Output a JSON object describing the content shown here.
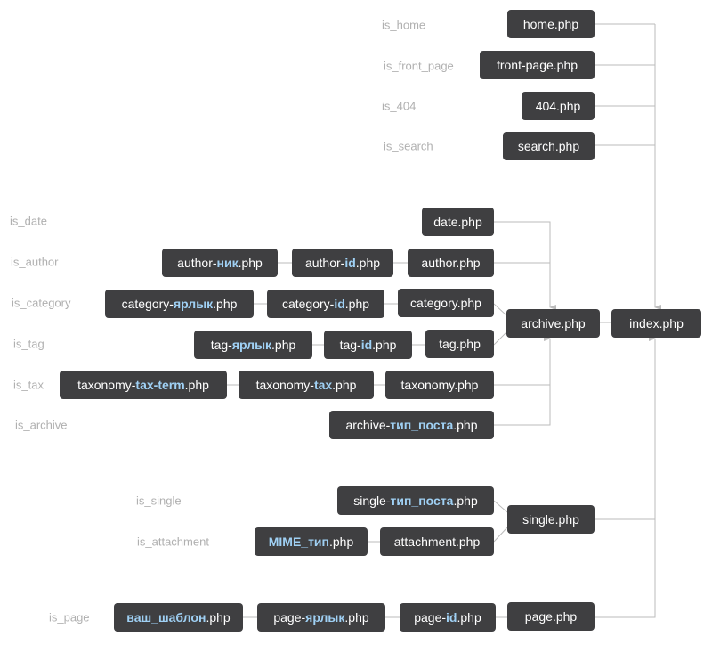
{
  "colors": {
    "node_bg": "#3f3f41",
    "node_text": "#ffffff",
    "highlight": "#9fd0f4",
    "line": "#bbbbbb",
    "condition_text": "#b0b0b0"
  },
  "conditions": [
    "is_home",
    "is_front_page",
    "is_404",
    "is_search",
    "is_date",
    "is_author",
    "is_category",
    "is_tag",
    "is_tax",
    "is_archive",
    "is_single",
    "is_attachment",
    "is_page"
  ],
  "nodes": {
    "home": {
      "pre": "home.php",
      "hl": "",
      "post": ""
    },
    "front_page": {
      "pre": "front-page.php",
      "hl": "",
      "post": ""
    },
    "e404": {
      "pre": "404.php",
      "hl": "",
      "post": ""
    },
    "search": {
      "pre": "search.php",
      "hl": "",
      "post": ""
    },
    "date": {
      "pre": "date.php",
      "hl": "",
      "post": ""
    },
    "author_nick": {
      "pre": "author-",
      "hl": "ник",
      "post": ".php"
    },
    "author_id": {
      "pre": "author-",
      "hl": "id",
      "post": ".php"
    },
    "author": {
      "pre": "author.php",
      "hl": "",
      "post": ""
    },
    "category_slug": {
      "pre": "category-",
      "hl": "ярлык",
      "post": ".php"
    },
    "category_id": {
      "pre": "category-",
      "hl": "id",
      "post": ".php"
    },
    "category": {
      "pre": "category.php",
      "hl": "",
      "post": ""
    },
    "tag_slug": {
      "pre": "tag-",
      "hl": "ярлык",
      "post": ".php"
    },
    "tag_id": {
      "pre": "tag-",
      "hl": "id",
      "post": ".php"
    },
    "tag": {
      "pre": "tag.php",
      "hl": "",
      "post": ""
    },
    "taxonomy_term": {
      "pre": "taxonomy-",
      "hl": "tax-term",
      "post": ".php"
    },
    "taxonomy_tax": {
      "pre": "taxonomy-",
      "hl": "tax",
      "post": ".php"
    },
    "taxonomy": {
      "pre": "taxonomy.php",
      "hl": "",
      "post": ""
    },
    "archive_type": {
      "pre": "archive-",
      "hl": "тип_поста",
      "post": ".php"
    },
    "archive": {
      "pre": "archive.php",
      "hl": "",
      "post": ""
    },
    "index": {
      "pre": "index.php",
      "hl": "",
      "post": ""
    },
    "single_type": {
      "pre": "single-",
      "hl": "тип_поста",
      "post": ".php"
    },
    "mime": {
      "pre": "",
      "hl": "MIME_тип",
      "post": ".php"
    },
    "attachment": {
      "pre": "attachment.php",
      "hl": "",
      "post": ""
    },
    "single": {
      "pre": "single.php",
      "hl": "",
      "post": ""
    },
    "custom_template": {
      "pre": "",
      "hl": "ваш_шаблон",
      "post": ".php"
    },
    "page_slug": {
      "pre": "page-",
      "hl": "ярлык",
      "post": ".php"
    },
    "page_id": {
      "pre": "page-",
      "hl": "id",
      "post": ".php"
    },
    "page": {
      "pre": "page.php",
      "hl": "",
      "post": ""
    }
  }
}
